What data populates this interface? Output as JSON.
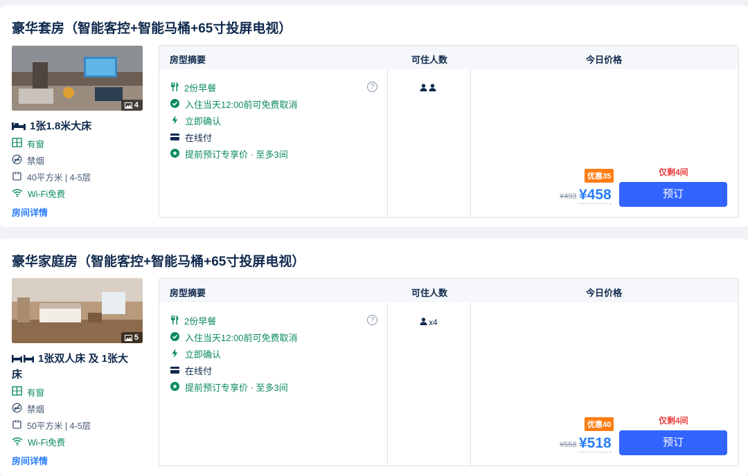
{
  "rooms": [
    {
      "title": "豪华套房（智能客控+智能马桶+65寸投屏电视）",
      "photo_count": "4",
      "bed": "1张1.8米大床",
      "window": "有窗",
      "smoking": "禁烟",
      "area_floor": "40平方米 | 4-5层",
      "wifi": "Wi-Fi免费",
      "detail_link": "房间详情",
      "table_headers": {
        "summary": "房型摘要",
        "occupancy": "可住人数",
        "price": "今日价格"
      },
      "policies": [
        "2份早餐",
        "入住当天12:00前可免费取消",
        "立即确认",
        "在线付",
        "提前预订专享价 · 至多3间"
      ],
      "occupancy_text": "",
      "discount": "优惠35",
      "rooms_left": "仅剩4间",
      "original_price": "¥493",
      "price": "¥458",
      "book": "预订"
    },
    {
      "title": "豪华家庭房（智能客控+智能马桶+65寸投屏电视）",
      "photo_count": "5",
      "bed": "1张双人床 及 1张大床",
      "window": "有窗",
      "smoking": "禁烟",
      "area_floor": "50平方米 | 4-5层",
      "wifi": "Wi-Fi免费",
      "detail_link": "房间详情",
      "table_headers": {
        "summary": "房型摘要",
        "occupancy": "可住人数",
        "price": "今日价格"
      },
      "policies": [
        "2份早餐",
        "入住当天12:00前可免费取消",
        "立即确认",
        "在线付",
        "提前预订专享价 · 至多3间"
      ],
      "occupancy_text": "x4",
      "discount": "优惠40",
      "rooms_left": "仅剩4间",
      "original_price": "¥558",
      "price": "¥518",
      "book": "预订"
    }
  ],
  "colors": {
    "accent": "#287dfa",
    "book_button": "#3264ff",
    "discount": "#ff7d13",
    "alert": "#eb3f3f",
    "policy_green": "#0a8a5f"
  },
  "icons": [
    "bed-icon",
    "window-icon",
    "no-smoking-icon",
    "area-icon",
    "wifi-icon",
    "cutlery-icon",
    "check-circle-icon",
    "lightning-icon",
    "card-icon",
    "star-badge-icon",
    "person-icon",
    "photo-icon",
    "help-icon"
  ]
}
